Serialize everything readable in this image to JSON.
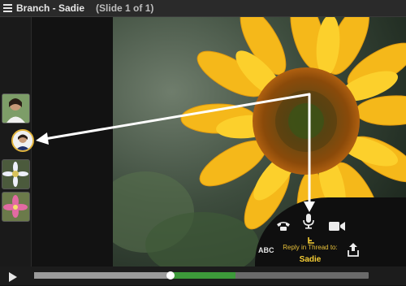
{
  "header": {
    "title": "Branch - Sadie",
    "slide_count": "(Slide 1 of 1)"
  },
  "reply": {
    "label": "Reply in Thread to:",
    "name": "Sadie",
    "text_tool": "ABC"
  },
  "icons": {
    "menu": "hamburger-icon",
    "phone": "phone-icon",
    "mic": "microphone-icon",
    "video": "video-camera-icon",
    "reply": "branch-reply-icon",
    "share": "share-upload-icon",
    "play": "play-icon"
  },
  "playback": {
    "progress": 0.4
  },
  "colors": {
    "accent": "#f5cd35",
    "progress_green": "#3d9a3a"
  }
}
